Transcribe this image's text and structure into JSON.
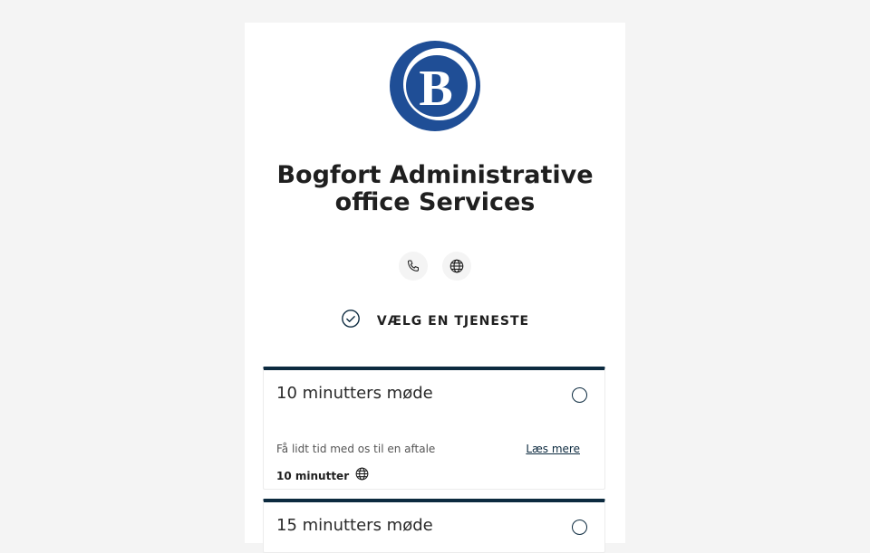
{
  "company": {
    "name": "Bogfort Administrative office Services",
    "logo_letter": "B",
    "brand_color": "#1f4e96"
  },
  "contact": {
    "phone_icon": "phone-icon",
    "website_icon": "globe-icon"
  },
  "step": {
    "icon": "check-circle-icon",
    "title": "VÆLG EN TJENESTE"
  },
  "services": [
    {
      "name": "10 minutters møde",
      "description": "Få lidt tid med os til en aftale",
      "read_more": "Læs mere",
      "duration": "10 minutter",
      "location_icon": "globe-icon"
    },
    {
      "name": "15 minutters møde"
    }
  ],
  "colors": {
    "page_background": "#f4f4f4",
    "card_accent": "#0c2a3f"
  }
}
